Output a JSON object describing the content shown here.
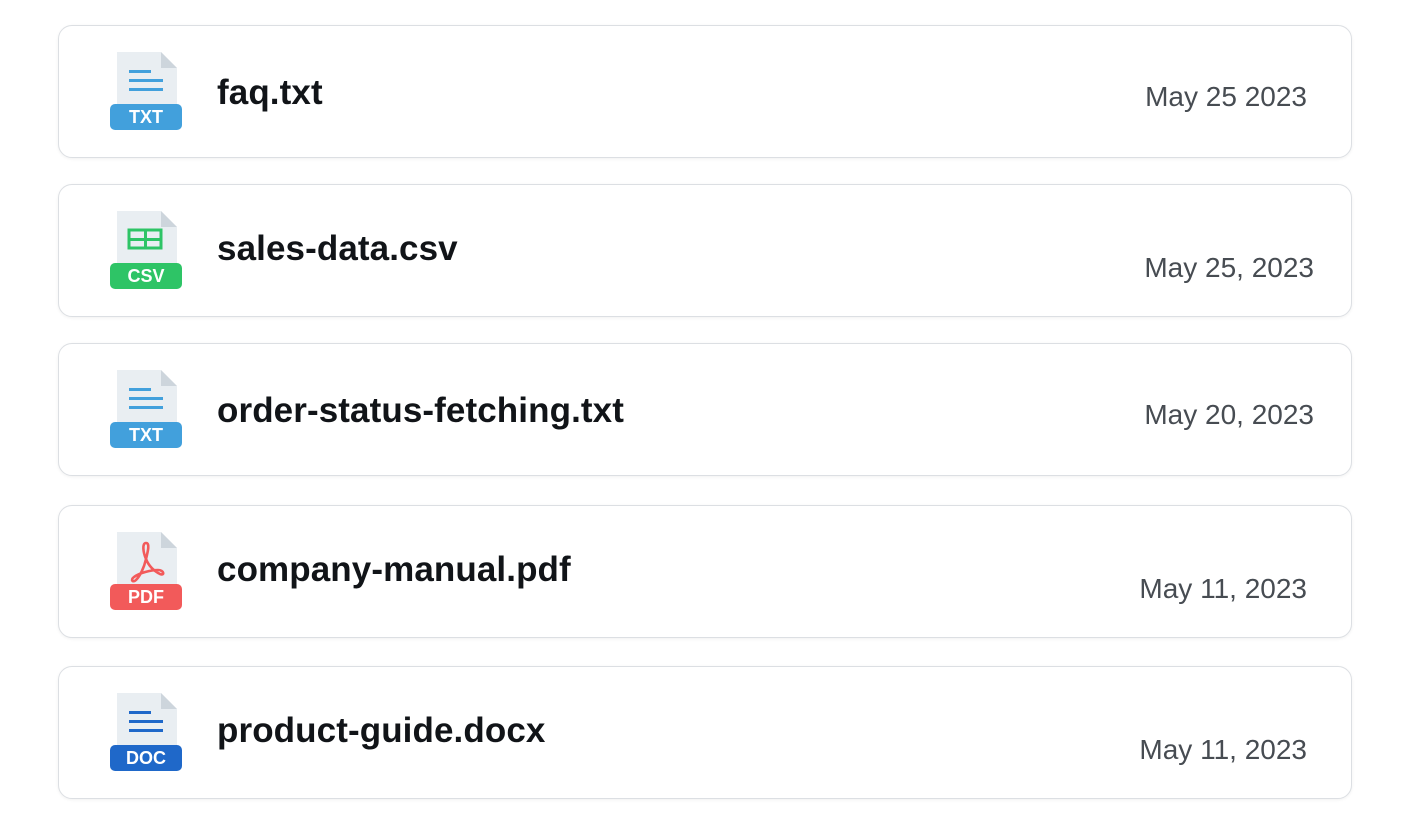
{
  "colors": {
    "txt": "#42a0dc",
    "csv": "#2ec466",
    "pdf": "#f25a5a",
    "doc": "#1f68c9",
    "page": "#e9eef2",
    "fold": "#cdd5dc"
  },
  "files": [
    {
      "name": "faq.txt",
      "date": "May 25 2023",
      "badge": "TXT",
      "icon": "text-file-icon"
    },
    {
      "name": "sales-data.csv",
      "date": "May 25, 2023",
      "badge": "CSV",
      "icon": "spreadsheet-file-icon"
    },
    {
      "name": "order-status-fetching.txt",
      "date": "May 20, 2023",
      "badge": "TXT",
      "icon": "text-file-icon"
    },
    {
      "name": "company-manual.pdf",
      "date": "May 11, 2023",
      "badge": "PDF",
      "icon": "pdf-file-icon"
    },
    {
      "name": "product-guide.docx",
      "date": "May 11, 2023",
      "badge": "DOC",
      "icon": "document-file-icon"
    }
  ]
}
